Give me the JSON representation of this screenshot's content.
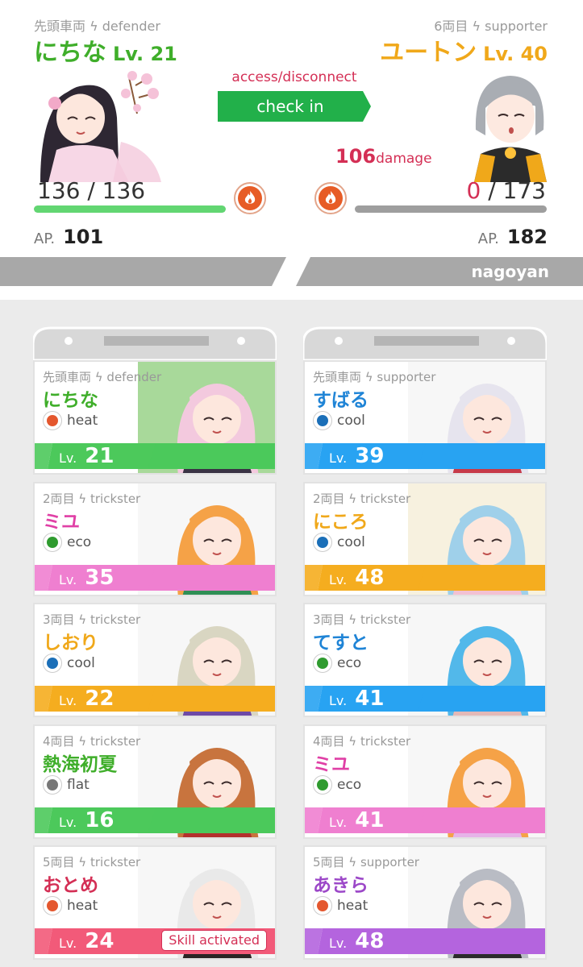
{
  "battle": {
    "left": {
      "role": "先頭車両 ϟ defender",
      "name": "にちな",
      "level": "Lv. 21",
      "hp": "136 / 136",
      "hp_fraction": 1.0,
      "ap_label": "AP.",
      "ap_value": "101",
      "name_color": "#3fae2a",
      "hp_color": "#62d672"
    },
    "right": {
      "role": "6両目 ϟ supporter",
      "name": "ユートン",
      "level": "Lv. 40",
      "hp_zero": "0",
      "hp_rest": " / 173",
      "hp_fraction": 0.0,
      "ap_label": "AP.",
      "ap_value": "182",
      "name_color": "#f0a81a"
    },
    "access_text": "access/disconnect",
    "checkin_label": "check in",
    "damage_value": "106",
    "damage_unit": "damage",
    "station_user": "nagoyan",
    "element_icon": "flame-icon"
  },
  "roster": {
    "left": [
      {
        "role": "先頭車両 ϟ defender",
        "name": "にちな",
        "element": "heat",
        "level_label": "Lv.",
        "level": "21",
        "name_color": "#3fae2a",
        "band_color": "#4cc95b",
        "elem_color": "#e4572e",
        "art": [
          "#a8d99a",
          "#f3c9de",
          "#3a3344"
        ]
      },
      {
        "role": "2両目 ϟ trickster",
        "name": "ミユ",
        "element": "eco",
        "level_label": "Lv.",
        "level": "35",
        "name_color": "#e040a6",
        "band_color": "#ef7fd0",
        "elem_color": "#2f9b2f",
        "art": [
          "#f7f7f7",
          "#f5a247",
          "#2f8f55"
        ]
      },
      {
        "role": "3両目 ϟ trickster",
        "name": "しおり",
        "element": "cool",
        "level_label": "Lv.",
        "level": "22",
        "name_color": "#f0a81a",
        "band_color": "#f5ad1f",
        "elem_color": "#1b6fb8",
        "art": [
          "#f7f7f7",
          "#d9d6c2",
          "#6e4aa6"
        ]
      },
      {
        "role": "4両目 ϟ trickster",
        "name": "熱海初夏",
        "element": "flat",
        "level_label": "Lv.",
        "level": "16",
        "name_color": "#3fae2a",
        "band_color": "#4cc95b",
        "elem_color": "#777777",
        "art": [
          "#f7f7f7",
          "#c8743e",
          "#b3302d"
        ]
      },
      {
        "role": "5両目 ϟ trickster",
        "name": "おとめ",
        "element": "heat",
        "level_label": "Lv.",
        "level": "24",
        "name_color": "#d42f55",
        "band_color": "#f25a79",
        "elem_color": "#e4572e",
        "art": [
          "#f7f7f7",
          "#e9e9e9",
          "#2b2524"
        ],
        "skill": "Skill activated"
      }
    ],
    "right": [
      {
        "role": "先頭車両 ϟ supporter",
        "name": "すばる",
        "element": "cool",
        "level_label": "Lv.",
        "level": "39",
        "name_color": "#1f84d6",
        "band_color": "#28a3f2",
        "elem_color": "#1b6fb8",
        "art": [
          "#f7f7f7",
          "#e6e4ee",
          "#c73a49"
        ]
      },
      {
        "role": "2両目 ϟ trickster",
        "name": "にころ",
        "element": "cool",
        "level_label": "Lv.",
        "level": "48",
        "name_color": "#f0a81a",
        "band_color": "#f5ad1f",
        "elem_color": "#1b6fb8",
        "art": [
          "#f7f1df",
          "#9fd0ea",
          "#f2c1d3"
        ]
      },
      {
        "role": "3両目 ϟ trickster",
        "name": "てすと",
        "element": "eco",
        "level_label": "Lv.",
        "level": "41",
        "name_color": "#1f84d6",
        "band_color": "#28a3f2",
        "elem_color": "#2f9b2f",
        "art": [
          "#f7f7f7",
          "#52b8ea",
          "#e3b9b7"
        ]
      },
      {
        "role": "4両目 ϟ trickster",
        "name": "ミユ",
        "element": "eco",
        "level_label": "Lv.",
        "level": "41",
        "name_color": "#e040a6",
        "band_color": "#ef7fd0",
        "elem_color": "#2f9b2f",
        "art": [
          "#f7f7f7",
          "#f5a247",
          "#e6b3e8"
        ]
      },
      {
        "role": "5両目 ϟ supporter",
        "name": "あきら",
        "element": "heat",
        "level_label": "Lv.",
        "level": "48",
        "name_color": "#9c48c8",
        "band_color": "#b464de",
        "elem_color": "#e4572e",
        "art": [
          "#f7f7f7",
          "#b9bcc4",
          "#2b2b2b"
        ]
      }
    ]
  },
  "colors": {
    "banner": "#a8a8a8",
    "checkin": "#22b04a",
    "damage": "#d42f55",
    "hp_empty": "#9e9e9e"
  }
}
